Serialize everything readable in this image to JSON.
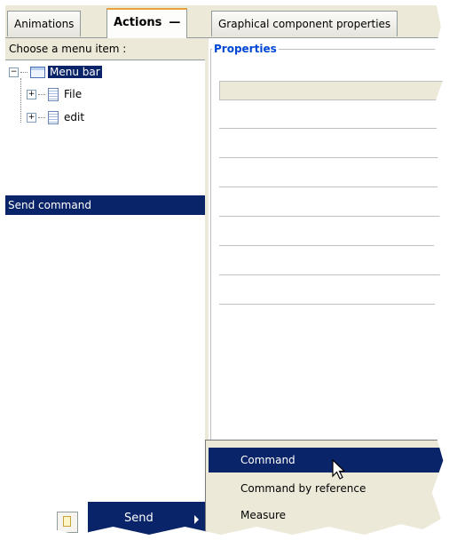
{
  "tabs": [
    {
      "label": "Animations"
    },
    {
      "label": "Actions",
      "close": "—"
    },
    {
      "label": "Graphical component properties"
    }
  ],
  "left_panel": {
    "header": "Choose a menu item :",
    "tree": {
      "root": {
        "label": "Menu bar",
        "expander": "−"
      },
      "children": [
        {
          "label": "File",
          "expander": "+"
        },
        {
          "label": "edit",
          "expander": "+"
        }
      ]
    },
    "selected_action": "Send command"
  },
  "right_panel": {
    "group_title": "Properties"
  },
  "context_menu": {
    "item_label": "Send",
    "submenu": [
      {
        "label": "Command",
        "highlighted": true
      },
      {
        "label": "Command by reference",
        "highlighted": false
      },
      {
        "label": "Measure",
        "highlighted": false
      }
    ]
  },
  "colors": {
    "selection": "#0a246a",
    "chrome": "#ece9d8",
    "group_title": "#0046d5",
    "active_tab_accent": "#e6a33a"
  },
  "icons": {
    "menubar": "menubar-icon",
    "document": "document-icon",
    "submenu_arrow": "chevron-right-icon",
    "cursor": "mouse-pointer-icon"
  }
}
